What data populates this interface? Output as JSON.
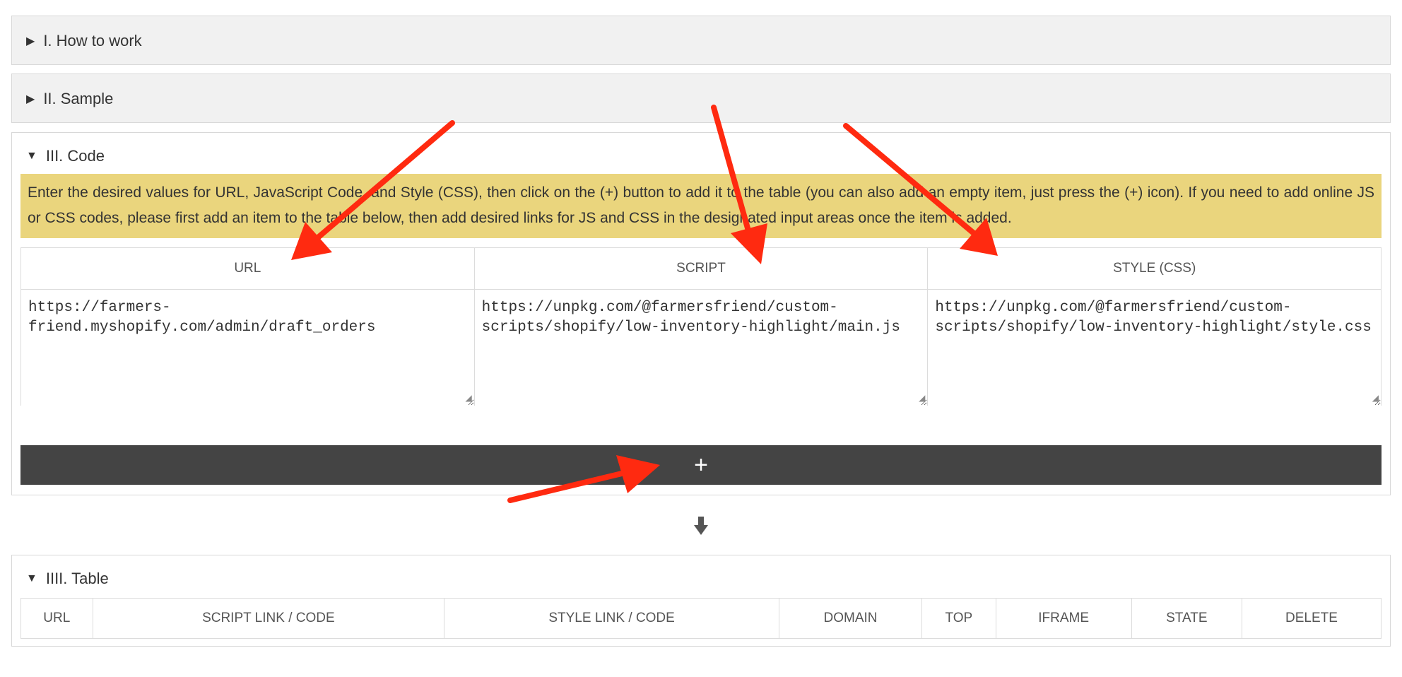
{
  "sections": {
    "how_to_work": {
      "title": "I. How to work",
      "expanded": false
    },
    "sample": {
      "title": "II. Sample",
      "expanded": false
    },
    "code": {
      "title": "III. Code",
      "expanded": true,
      "notice": "Enter the desired values for URL, JavaScript Code, and Style (CSS), then click on the (+) button to add it to the table (you can also add an empty item, just press the (+) icon). If you need to add online JS or CSS codes, please first add an item to the table below, then add desired links for JS and CSS in the designated input areas once the item is added.",
      "columns": [
        {
          "header": "URL",
          "value": "https://farmers-friend.myshopify.com/admin/draft_orders"
        },
        {
          "header": "SCRIPT",
          "value": "https://unpkg.com/@farmersfriend/custom-scripts/shopify/low-inventory-highlight/main.js"
        },
        {
          "header": "STYLE (CSS)",
          "value": "https://unpkg.com/@farmersfriend/custom-scripts/shopify/low-inventory-highlight/style.css"
        }
      ],
      "add_button_label": "+"
    },
    "table": {
      "title": "IIII. Table",
      "expanded": true,
      "headers": [
        "URL",
        "SCRIPT LINK / CODE",
        "STYLE LINK / CODE",
        "DOMAIN",
        "TOP",
        "IFRAME",
        "STATE",
        "DELETE"
      ]
    }
  },
  "icons": {
    "collapsed": "triangle-right-icon",
    "expanded": "triangle-down-icon",
    "down_arrow": "arrow-down-icon",
    "resize": "resize-grip-icon"
  },
  "colors": {
    "collapsed_bg": "#f1f1f1",
    "notice_bg": "#ead57d",
    "add_bar_bg": "#444444",
    "annotation_arrow": "#ff2a10"
  }
}
